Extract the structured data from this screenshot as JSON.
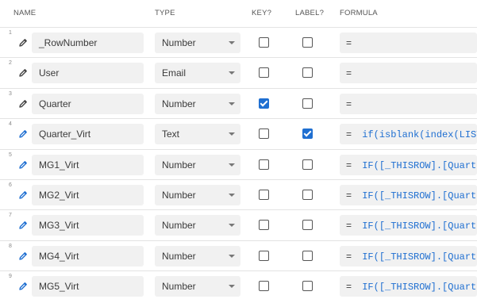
{
  "header": {
    "name": "NAME",
    "type": "TYPE",
    "key": "KEY?",
    "label": "LABEL?",
    "formula": "FORMULA"
  },
  "colors": {
    "accent": "#1f6fd1",
    "field_bg": "#f1f1f1"
  },
  "rows": [
    {
      "num": "1",
      "name": "_RowNumber",
      "type": "Number",
      "key": false,
      "label": false,
      "eq": "=",
      "formula": "",
      "icon": "pencil-icon"
    },
    {
      "num": "2",
      "name": "User",
      "type": "Email",
      "key": false,
      "label": false,
      "eq": "=",
      "formula": "",
      "icon": "pencil-icon"
    },
    {
      "num": "3",
      "name": "Quarter",
      "type": "Number",
      "key": true,
      "label": false,
      "eq": "=",
      "formula": "",
      "icon": "pencil-icon"
    },
    {
      "num": "4",
      "name": "Quarter_Virt",
      "type": "Text",
      "key": false,
      "label": true,
      "eq": "=",
      "formula": "if(isblank(index(LIST",
      "icon": "pencil-icon"
    },
    {
      "num": "5",
      "name": "MG1_Virt",
      "type": "Number",
      "key": false,
      "label": false,
      "eq": "=",
      "formula": "IF([_THISROW].[Quarte",
      "icon": "pencil-icon"
    },
    {
      "num": "6",
      "name": "MG2_Virt",
      "type": "Number",
      "key": false,
      "label": false,
      "eq": "=",
      "formula": "IF([_THISROW].[Quarte",
      "icon": "pencil-icon"
    },
    {
      "num": "7",
      "name": "MG3_Virt",
      "type": "Number",
      "key": false,
      "label": false,
      "eq": "=",
      "formula": "IF([_THISROW].[Quarte",
      "icon": "pencil-icon"
    },
    {
      "num": "8",
      "name": "MG4_Virt",
      "type": "Number",
      "key": false,
      "label": false,
      "eq": "=",
      "formula": "IF([_THISROW].[Quarte",
      "icon": "pencil-icon"
    },
    {
      "num": "9",
      "name": "MG5_Virt",
      "type": "Number",
      "key": false,
      "label": false,
      "eq": "=",
      "formula": "IF([_THISROW].[Quarte",
      "icon": "pencil-icon"
    }
  ]
}
